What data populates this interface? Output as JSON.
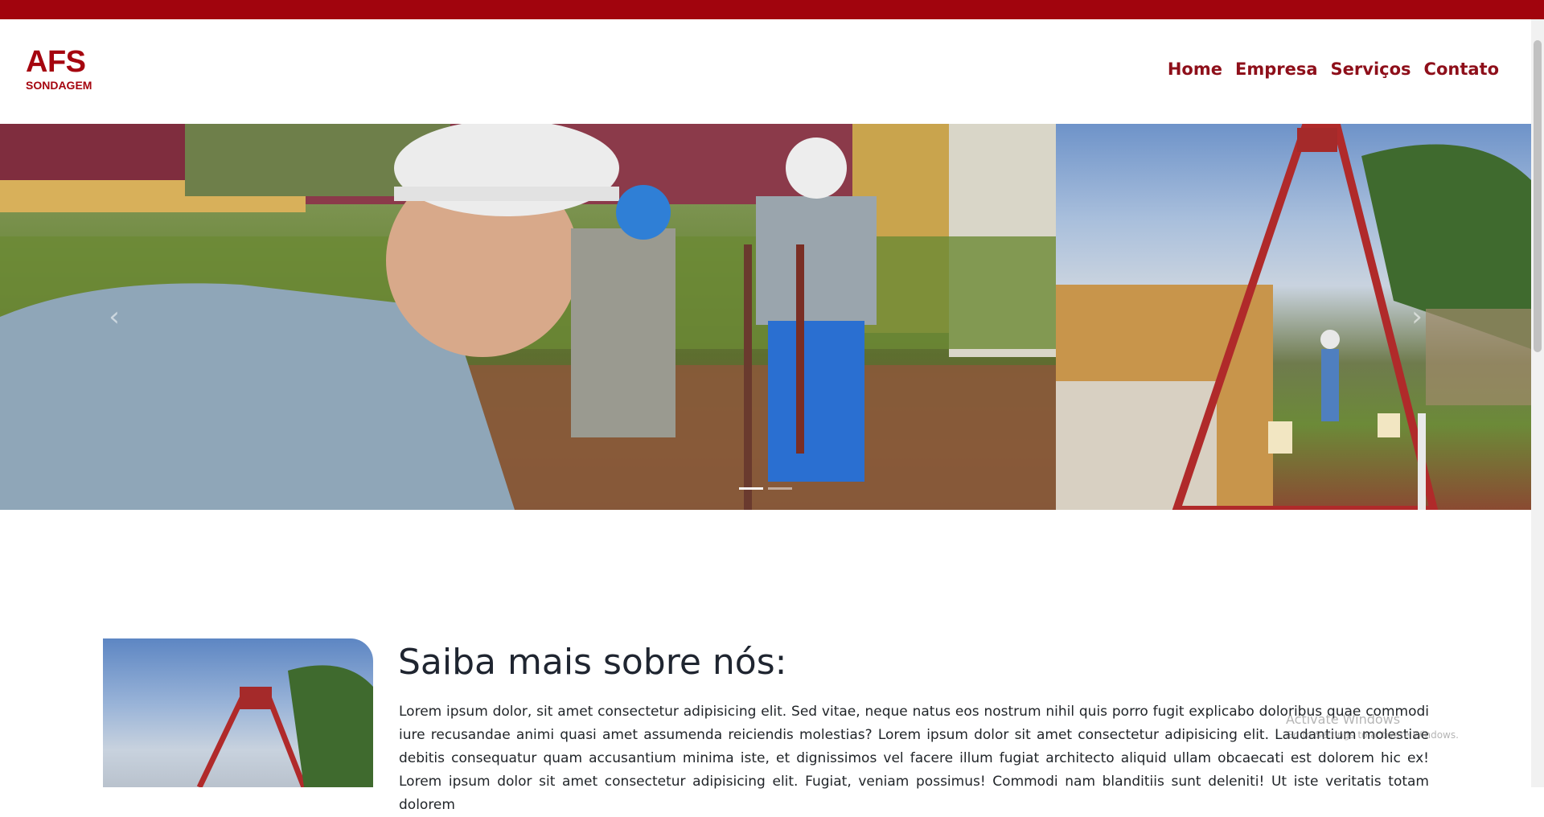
{
  "brand": {
    "name": "AFS",
    "tagline": "SONDAGEM",
    "color": "#a5050f",
    "top_strip_color": "#a1040d"
  },
  "nav": {
    "items": [
      "Home",
      "Empresa",
      "Serviços",
      "Contato"
    ],
    "color": "#8e0f1a"
  },
  "hero": {
    "slide_count": 2,
    "active_slide": 1
  },
  "about": {
    "title": "Saiba mais sobre nós:",
    "body": "Lorem ipsum dolor, sit amet consectetur adipisicing elit. Sed vitae, neque natus eos nostrum nihil quis porro fugit explicabo doloribus quae commodi iure recusandae animi quasi amet assumenda reiciendis molestias? Lorem ipsum dolor sit amet consectetur adipisicing elit. Laudantium molestiae debitis consequatur quam accusantium minima iste, et dignissimos vel facere illum fugiat architecto aliquid ullam obcaecati est dolorem hic ex! Lorem ipsum dolor sit amet consectetur adipisicing elit. Fugiat, veniam possimus! Commodi nam blanditiis sunt deleniti! Ut iste veritatis totam dolorem"
  },
  "watermark": {
    "title": "Activate Windows",
    "subtitle": "Go to Settings to activate Windows."
  }
}
